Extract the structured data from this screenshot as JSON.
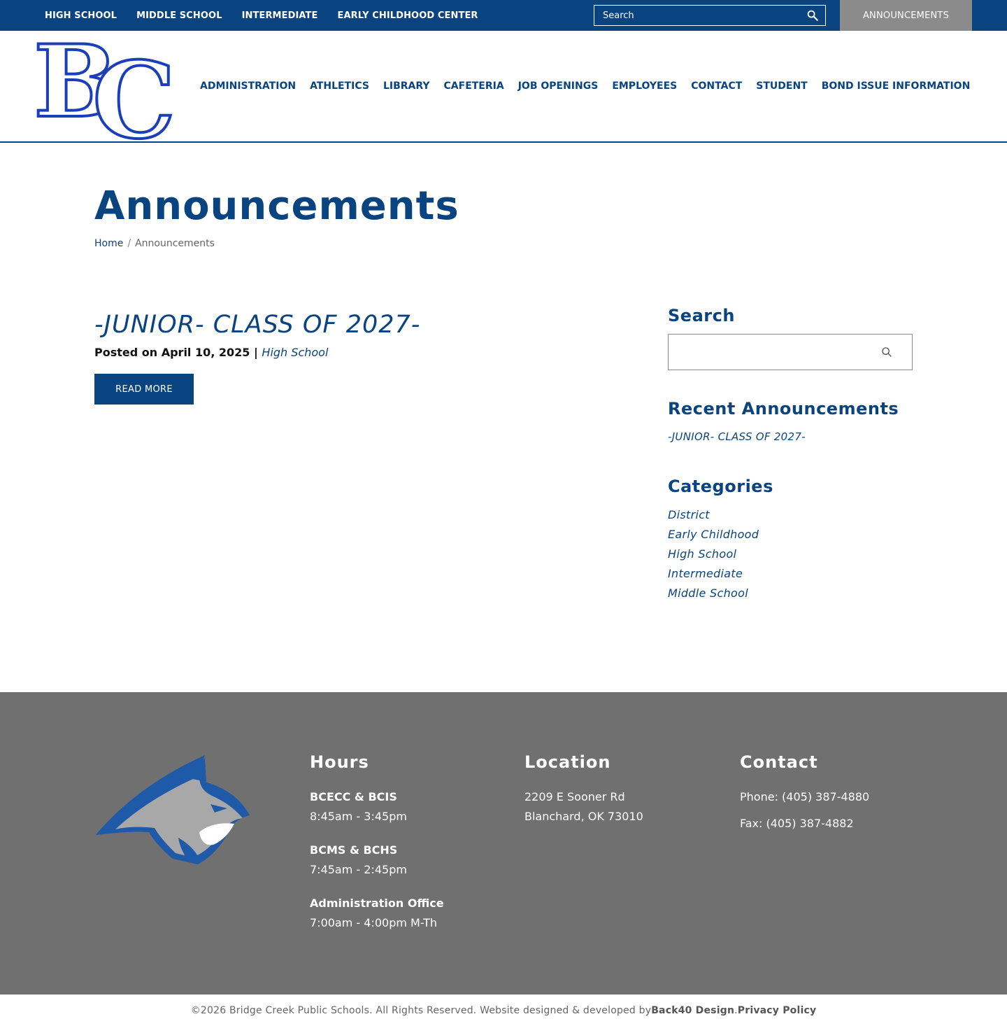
{
  "colors": {
    "primary": "#0a4480",
    "topbar": "#0a4480",
    "announce_tab": "#8b8b8b",
    "footer": "#707070",
    "logo_blue": "#1a3fb8"
  },
  "topnav": {
    "items": [
      "HIGH SCHOOL",
      "MIDDLE SCHOOL",
      "INTERMEDIATE",
      "EARLY CHILDHOOD CENTER"
    ],
    "search_placeholder": "Search",
    "search_icon": "search-icon",
    "announcements_label": "ANNOUNCEMENTS"
  },
  "header": {
    "logo_alt": "BC",
    "nav": [
      "ADMINISTRATION",
      "ATHLETICS",
      "LIBRARY",
      "CAFETERIA",
      "JOB OPENINGS",
      "EMPLOYEES",
      "CONTACT",
      "STUDENT",
      "BOND ISSUE INFORMATION"
    ]
  },
  "page": {
    "title": "Announcements",
    "breadcrumb": {
      "home": "Home",
      "separator": "/",
      "current": "Announcements"
    }
  },
  "post": {
    "title": "-JUNIOR- CLASS OF 2027-",
    "posted_prefix": "Posted on April 10, 2025 |",
    "category": "High School",
    "read_more": "READ MORE"
  },
  "sidebar": {
    "search_heading": "Search",
    "search_icon": "search-icon",
    "recent_heading": "Recent Announcements",
    "recent_items": [
      "-JUNIOR- CLASS OF 2027-"
    ],
    "categories_heading": "Categories",
    "categories": [
      "District",
      "Early Childhood",
      "High School",
      "Intermediate",
      "Middle School"
    ]
  },
  "footer": {
    "hours": {
      "heading": "Hours",
      "blocks": [
        {
          "label": "BCECC & BCIS",
          "time": "8:45am - 3:45pm"
        },
        {
          "label": "BCMS & BCHS",
          "time": "7:45am - 2:45pm"
        },
        {
          "label": "Administration Office",
          "time": "7:00am - 4:00pm M-Th"
        }
      ]
    },
    "location": {
      "heading": "Location",
      "line1": "2209 E Sooner Rd",
      "line2": "Blanchard, OK 73010"
    },
    "contact": {
      "heading": "Contact",
      "phone": "Phone: (405) 387-4880",
      "fax": "Fax: (405) 387-4882"
    }
  },
  "bottom": {
    "copyright": "©2026 Bridge Creek Public Schools. All Rights Reserved. Website designed & developed by ",
    "designer": "Back40 Design",
    "dot": ". ",
    "privacy": "Privacy Policy"
  }
}
